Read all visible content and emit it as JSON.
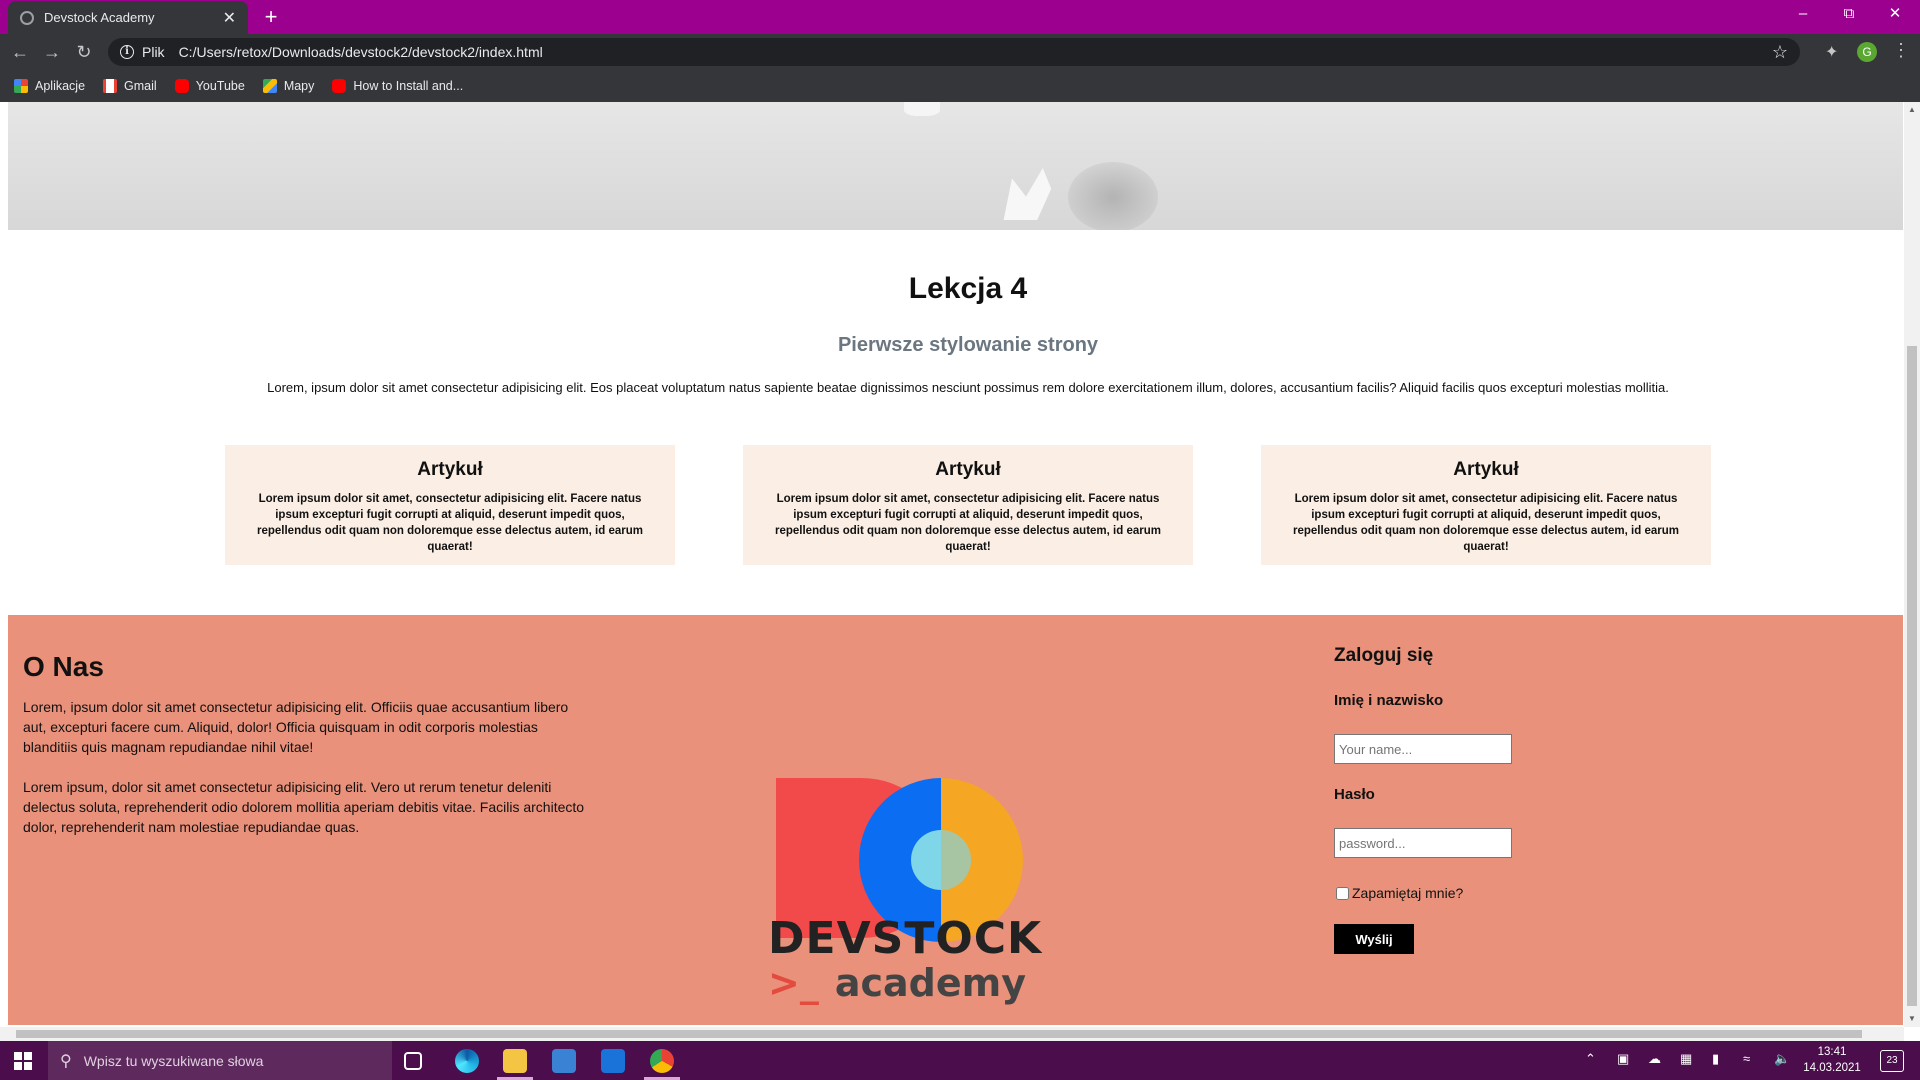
{
  "browser": {
    "tab_title": "Devstock Academy",
    "tab_close": "✕",
    "new_tab": "+",
    "address_scheme": "Plik",
    "address_url": "C:/Users/retox/Downloads/devstock2/devstock2/index.html",
    "bookmarks": [
      {
        "label": "Aplikacje",
        "icon": "apps-grid-icon"
      },
      {
        "label": "Gmail",
        "icon": "gmail-icon"
      },
      {
        "label": "YouTube",
        "icon": "youtube-icon"
      },
      {
        "label": "Mapy",
        "icon": "maps-icon"
      },
      {
        "label": "How to Install and...",
        "icon": "youtube-icon"
      }
    ],
    "profile_initial": "G"
  },
  "page": {
    "lesson": {
      "title": "Lekcja 4",
      "subtitle": "Pierwsze stylowanie strony",
      "text": "Lorem, ipsum dolor sit amet consectetur adipisicing elit. Eos placeat voluptatum natus sapiente beatae dignissimos nesciunt possimus rem dolore exercitationem illum, dolores, accusantium facilis? Aliquid facilis quos excepturi molestias mollitia."
    },
    "cards": [
      {
        "title": "Artykuł",
        "text": "Lorem ipsum dolor sit amet, consectetur adipisicing elit. Facere natus ipsum excepturi fugit corrupti at aliquid, deserunt impedit quos, repellendus odit quam non doloremque esse delectus autem, id earum quaerat!"
      },
      {
        "title": "Artykuł",
        "text": "Lorem ipsum dolor sit amet, consectetur adipisicing elit. Facere natus ipsum excepturi fugit corrupti at aliquid, deserunt impedit quos, repellendus odit quam non doloremque esse delectus autem, id earum quaerat!"
      },
      {
        "title": "Artykuł",
        "text": "Lorem ipsum dolor sit amet, consectetur adipisicing elit. Facere natus ipsum excepturi fugit corrupti at aliquid, deserunt impedit quos, repellendus odit quam non doloremque esse delectus autem, id earum quaerat!"
      }
    ],
    "about": {
      "title": "O Nas",
      "p1": "Lorem, ipsum dolor sit amet consectetur adipisicing elit. Officiis quae accusantium libero aut, excepturi facere cum. Aliquid, dolor! Officia quisquam in odit corporis molestias blanditiis quis magnam repudiandae nihil vitae!",
      "p2": "Lorem ipsum, dolor sit amet consectetur adipisicing elit. Vero ut rerum tenetur deleniti delectus soluta, reprehenderit odio dolorem mollitia aperiam debitis vitae. Facilis architecto dolor, reprehenderit nam molestiae repudiandae quas."
    },
    "logo": {
      "word": "DEVSTOCK",
      "prompt": ">_",
      "sub": "academy"
    },
    "login": {
      "title": "Zaloguj się",
      "name_label": "Imię i nazwisko",
      "name_placeholder": "Your name...",
      "password_label": "Hasło",
      "password_placeholder": "password...",
      "remember_label": "Zapamiętaj mnie?",
      "submit_label": "Wyślij"
    }
  },
  "taskbar": {
    "search_placeholder": "Wpisz tu wyszukiwane słowa",
    "time": "13:41",
    "date": "14.03.2021",
    "notifications": "23"
  },
  "colors": {
    "titlebar": "#9b008f",
    "footer": "#e9917a",
    "card": "#fbeee4",
    "taskbar": "#4b0d4b"
  }
}
